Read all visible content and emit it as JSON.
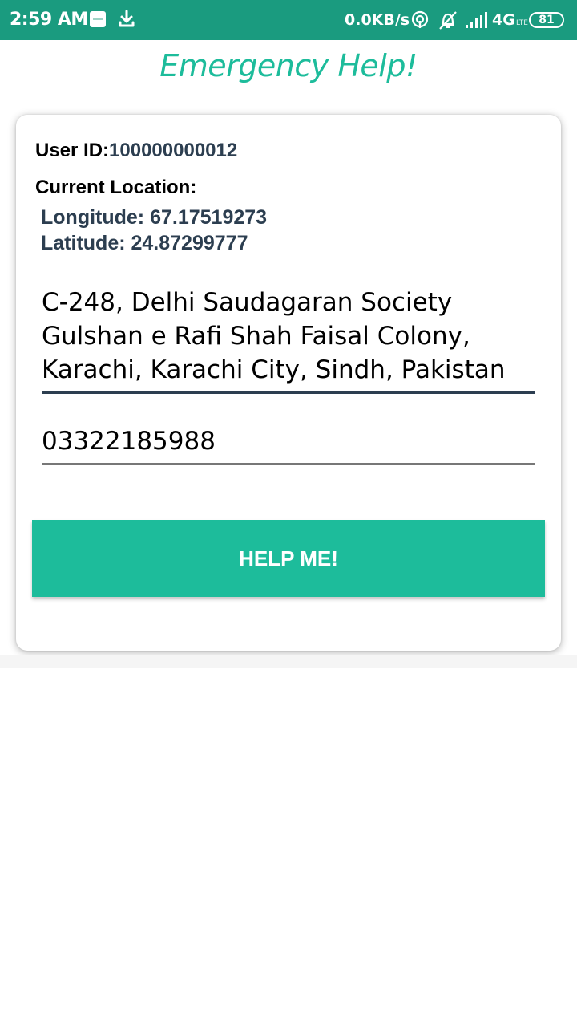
{
  "status_bar": {
    "time": "2:59 AM",
    "net_speed": "0.0KB/s",
    "network": "4G",
    "network_small": "LTE",
    "battery": "81",
    "icons": [
      "notification-app-icon",
      "download-icon",
      "hotspot-icon",
      "alarm-off-icon",
      "signal-icon",
      "battery-icon"
    ]
  },
  "header": {
    "title": "Emergency Help!"
  },
  "card": {
    "user_id_label": "User ID:",
    "user_id": "100000000012",
    "location_label": "Current Location:",
    "longitude": "Longitude: 67.17519273",
    "latitude": "Latitude: 24.87299777",
    "address_lines": [
      "C-248, Delhi Saudagaran Society",
      "Gulshan e Rafi Shah Faisal Colony,",
      "Karachi, Karachi City, Sindh, Pakistan"
    ],
    "phone": "03322185988",
    "help_button": "HELP ME!"
  },
  "colors": {
    "status_bar": "#1a9b7f",
    "accent": "#1dbc9b",
    "value_text": "#2c3e50"
  }
}
